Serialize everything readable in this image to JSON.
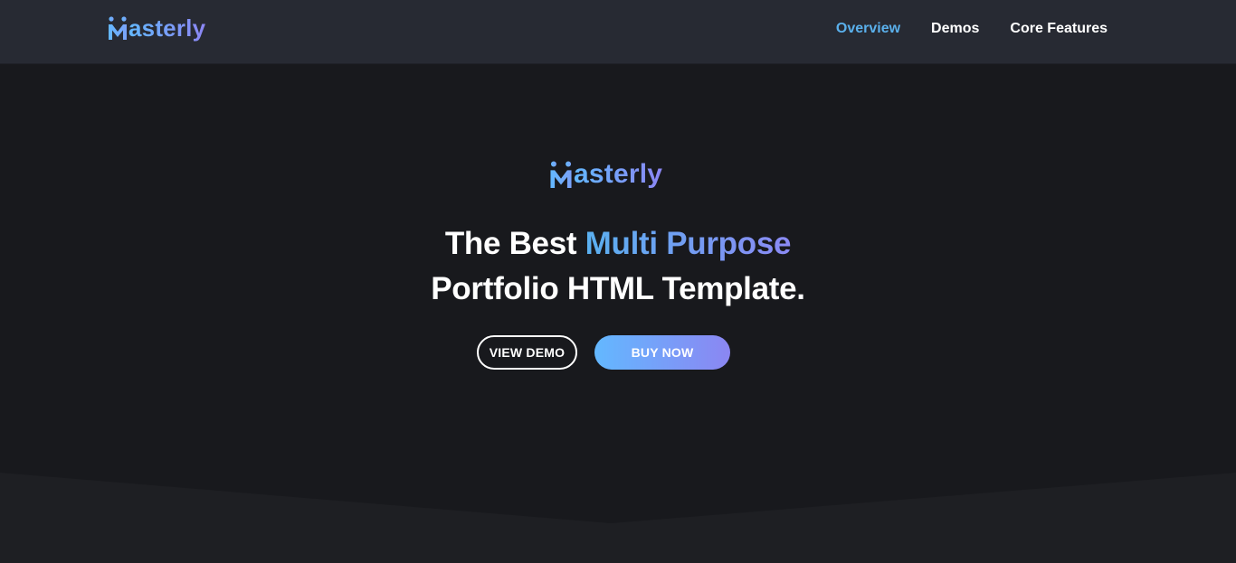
{
  "brand": {
    "name": "asterly",
    "logo_icon": "masterly-m-logo-icon",
    "gradient_start": "#63b8ff",
    "gradient_end": "#8c86f4"
  },
  "nav": {
    "items": [
      {
        "label": "Overview",
        "active": true
      },
      {
        "label": "Demos",
        "active": false
      },
      {
        "label": "Core Features",
        "active": false
      }
    ],
    "active_color": "#5ab0ec"
  },
  "hero": {
    "headline_part1": "The Best ",
    "headline_accent": "Multi Purpose",
    "headline_line2": "Portfolio HTML Template.",
    "view_demo_label": "VIEW DEMO",
    "buy_now_label": "BUY NOW"
  },
  "colors": {
    "navbar_bg": "#272a33",
    "hero_bg": "#18191d",
    "text": "#ffffff"
  }
}
